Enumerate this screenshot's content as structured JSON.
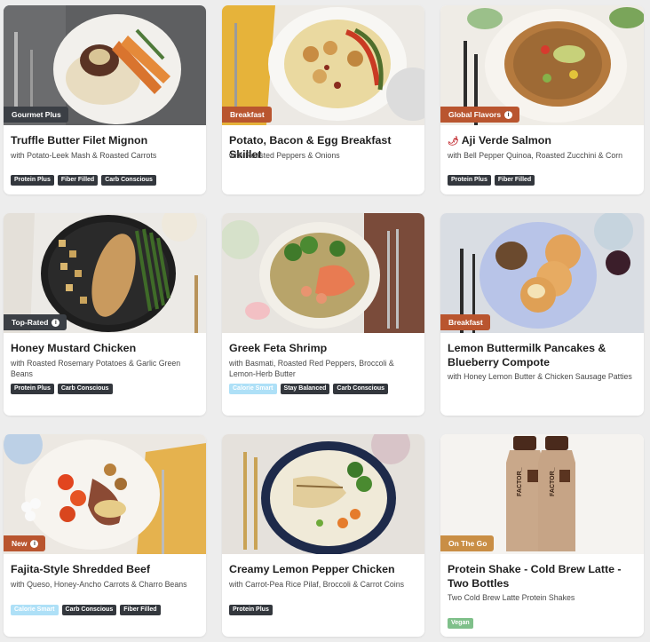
{
  "colors": {
    "tag_dark": "#3b3f45",
    "tag_orange": "#b9552f",
    "tag_gold": "#c98e45",
    "badge_dark": "#33373d",
    "badge_light": "#aee0f7",
    "badge_green": "#7fc08a"
  },
  "meals": [
    {
      "tag": "Gourmet Plus",
      "tag_info": false,
      "title": "Truffle Butter Filet Mignon",
      "subtitle": "with Potato-Leek Mash & Roasted Carrots",
      "badges": [
        "Protein Plus",
        "Fiber Filled",
        "Carb Conscious"
      ]
    },
    {
      "tag": "Breakfast",
      "tag_info": false,
      "title": "Potato, Bacon & Egg Breakfast Skillet",
      "subtitle": "with Roasted Peppers & Onions",
      "badges": []
    },
    {
      "tag": "Global Flavors",
      "tag_info": true,
      "title": "Aji Verde Salmon",
      "title_icon": "chili-pepper-icon",
      "subtitle": "with Bell Pepper Quinoa, Roasted Zucchini & Corn",
      "badges": [
        "Protein Plus",
        "Fiber Filled"
      ]
    },
    {
      "tag": "Top-Rated",
      "tag_info": true,
      "title": "Honey Mustard Chicken",
      "subtitle": "with Roasted Rosemary Potatoes & Garlic Green Beans",
      "badges": [
        "Protein Plus",
        "Carb Conscious"
      ]
    },
    {
      "tag": "",
      "tag_info": false,
      "title": "Greek Feta Shrimp",
      "subtitle": "with Basmati, Roasted Red Peppers, Broccoli & Lemon-Herb Butter",
      "badges": [
        "Calorie Smart",
        "Stay Balanced",
        "Carb Conscious"
      ]
    },
    {
      "tag": "Breakfast",
      "tag_info": false,
      "title": "Lemon Buttermilk Pancakes & Blueberry Compote",
      "subtitle": "with Honey Lemon Butter & Chicken Sausage Patties",
      "badges": []
    },
    {
      "tag": "New",
      "tag_info": true,
      "title": "Fajita-Style Shredded Beef",
      "subtitle": "with Queso, Honey-Ancho Carrots & Charro Beans",
      "badges": [
        "Calorie Smart",
        "Carb Conscious",
        "Fiber Filled"
      ]
    },
    {
      "tag": "",
      "tag_info": false,
      "title": "Creamy Lemon Pepper Chicken",
      "subtitle": "with Carrot-Pea Rice Pilaf, Broccoli & Carrot Coins",
      "badges": [
        "Protein Plus"
      ]
    },
    {
      "tag": "On The Go",
      "tag_info": false,
      "title": "Protein Shake - Cold Brew Latte - Two Bottles",
      "subtitle": "Two Cold Brew Latte Protein Shakes",
      "badges": [
        "Vegan"
      ]
    }
  ],
  "bottle_label": "FACTOR_"
}
